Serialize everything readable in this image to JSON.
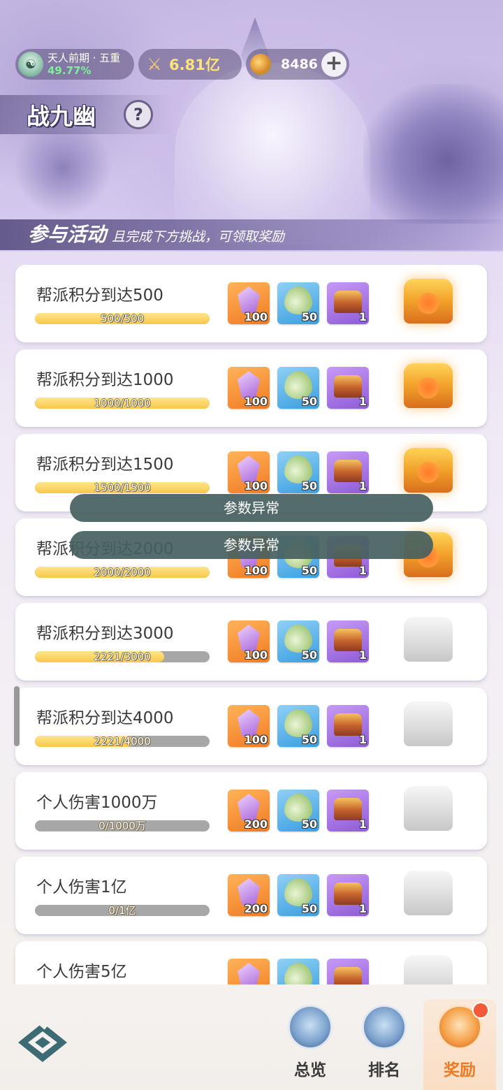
{
  "header": {
    "realm_name": "天人前期 · 五重",
    "realm_progress": "49.77%",
    "power_value": "6.81亿",
    "currency_value": "8486",
    "currency_add_label": "+",
    "event_title": "战九幽",
    "help_label": "?"
  },
  "notice": {
    "main": "参与活动",
    "sub": "且完成下方挑战，可领取奖励"
  },
  "tasks": [
    {
      "name": "帮派积分到达500",
      "progress_text": "500/500",
      "progress": 1.0,
      "rewards": [
        "100",
        "50",
        "1"
      ],
      "chest": "claimable"
    },
    {
      "name": "帮派积分到达1000",
      "progress_text": "1000/1000",
      "progress": 1.0,
      "rewards": [
        "100",
        "50",
        "1"
      ],
      "chest": "claimable"
    },
    {
      "name": "帮派积分到达1500",
      "progress_text": "1500/1500",
      "progress": 1.0,
      "rewards": [
        "100",
        "50",
        "1"
      ],
      "chest": "claimable"
    },
    {
      "name": "帮派积分到达2000",
      "progress_text": "2000/2000",
      "progress": 1.0,
      "rewards": [
        "100",
        "50",
        "1"
      ],
      "chest": "claimable"
    },
    {
      "name": "帮派积分到达3000",
      "progress_text": "2221/3000",
      "progress": 0.74,
      "rewards": [
        "100",
        "50",
        "1"
      ],
      "chest": "locked"
    },
    {
      "name": "帮派积分到达4000",
      "progress_text": "2221/4000",
      "progress": 0.555,
      "rewards": [
        "100",
        "50",
        "1"
      ],
      "chest": "locked"
    },
    {
      "name": "个人伤害1000万",
      "progress_text": "0/1000万",
      "progress": 0,
      "rewards": [
        "200",
        "50",
        "1"
      ],
      "chest": "locked"
    },
    {
      "name": "个人伤害1亿",
      "progress_text": "0/1亿",
      "progress": 0,
      "rewards": [
        "200",
        "50",
        "1"
      ],
      "chest": "locked"
    },
    {
      "name": "个人伤害5亿",
      "progress_text": "",
      "progress": 0,
      "rewards": [
        "",
        "",
        ""
      ],
      "chest": "locked"
    }
  ],
  "toasts": [
    "参数异常",
    "参数异常"
  ],
  "nav": {
    "overview": "总览",
    "rank": "排名",
    "reward": "奖励"
  },
  "colors": {
    "progress_fill": "#f7c84a",
    "progress_track": "#a7a7a7",
    "toast_bg": "#465f5f",
    "active_tab": "#f07a22"
  },
  "icons": {
    "reward_1": "purple-crystal-icon",
    "reward_2": "green-jade-drop-icon",
    "reward_3": "treasure-chest-icon",
    "claim": "golden-chest-icon"
  }
}
